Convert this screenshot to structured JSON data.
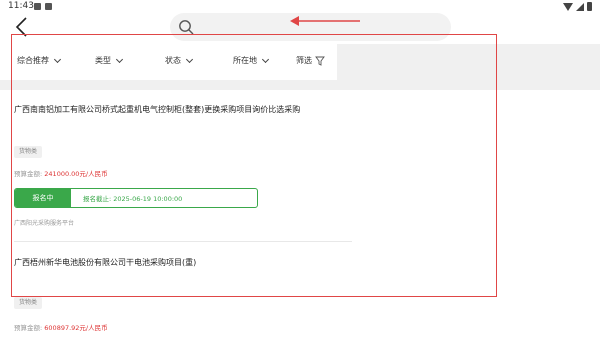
{
  "status_bar": {
    "time": "11:43"
  },
  "header": {
    "back_icon": "chevron-left-icon",
    "search_icon": "search-icon",
    "search_placeholder": "",
    "search_value": ""
  },
  "filters": [
    {
      "label": "综合推荐",
      "icon": "chevron-down-icon"
    },
    {
      "label": "类型",
      "icon": "chevron-down-icon"
    },
    {
      "label": "状态",
      "icon": "chevron-down-icon"
    },
    {
      "label": "所在地",
      "icon": "chevron-down-icon"
    },
    {
      "label": "筛选",
      "icon": "filter-icon"
    }
  ],
  "items": [
    {
      "title": "广西南南铝加工有限公司桥式起重机电气控制柜(整套)更换采购项目询价比选采购",
      "tag": "货物类",
      "budget_label": "预算金额:",
      "budget_amount": "241000.00元/人民币",
      "status": "报名中",
      "deadline": "报名截止: 2025-06-19 10:00:00",
      "source": "广西阳光采购服务平台"
    },
    {
      "title": "广西梧州新华电池股份有限公司干电池采购项目(重)",
      "tag": "货物类",
      "budget_label": "预算金额:",
      "budget_amount": "600897.92元/人民币"
    }
  ],
  "colors": {
    "accent_green": "#3aa84a",
    "amount_red": "#d33333",
    "annotation_red": "#e04646"
  }
}
